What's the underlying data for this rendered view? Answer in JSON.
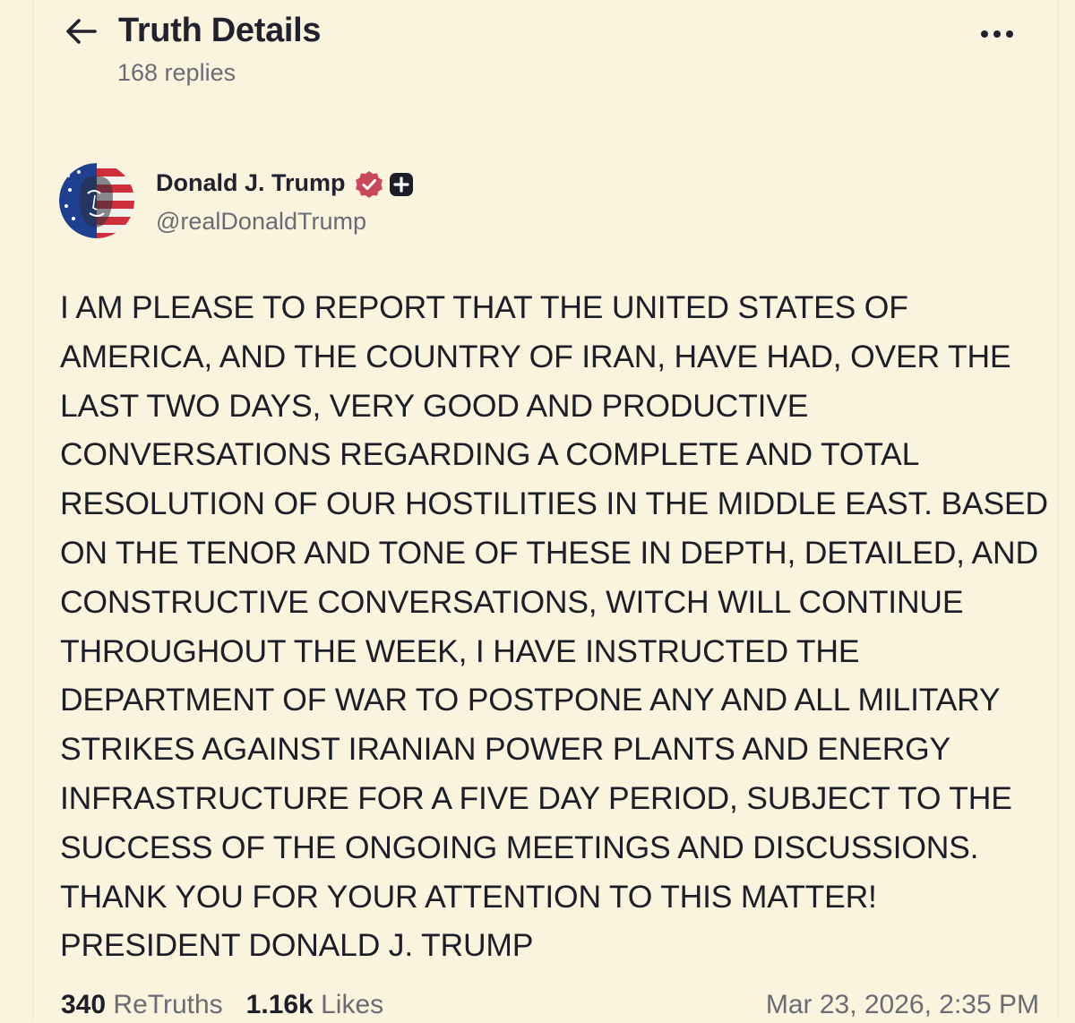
{
  "header": {
    "title": "Truth Details",
    "reply_count": "168 replies",
    "back_icon": "arrow-left-icon",
    "more_icon": "more-horizontal-icon"
  },
  "post": {
    "author": {
      "display_name": "Donald J. Trump",
      "handle": "@realDonaldTrump",
      "verified_icon": "verified-badge-icon",
      "plus_icon": "plus-badge-icon",
      "verified_color": "#c9485b"
    },
    "body_lines": [
      "I AM PLEASE TO REPORT THAT THE UNITED STATES OF",
      "AMERICA, AND THE COUNTRY OF IRAN, HAVE HAD, OVER THE",
      "LAST TWO DAYS, VERY GOOD AND PRODUCTIVE",
      "CONVERSATIONS REGARDING A COMPLETE AND TOTAL",
      "RESOLUTION OF OUR HOSTILITIES IN THE MIDDLE EAST. BASED",
      "ON THE TENOR AND TONE OF THESE IN DEPTH, DETAILED, AND",
      "CONSTRUCTIVE CONVERSATIONS, WITCH WILL CONTINUE",
      "THROUGHOUT THE WEEK, I HAVE INSTRUCTED THE",
      "DEPARTMENT OF WAR TO POSTPONE ANY AND ALL MILITARY",
      "STRIKES AGAINST IRANIAN POWER PLANTS AND ENERGY",
      "INFRASTRUCTURE FOR A FIVE DAY PERIOD, SUBJECT TO THE",
      "SUCCESS OF THE ONGOING MEETINGS AND DISCUSSIONS.",
      "THANK YOU FOR YOUR ATTENTION TO THIS MATTER!",
      "PRESIDENT DONALD J. TRUMP"
    ],
    "stats": {
      "retruths_count": "340",
      "retruths_label": "ReTruths",
      "likes_count": "1.16k",
      "likes_label": "Likes"
    },
    "timestamp": "Mar 23, 2026, 2:35 PM"
  },
  "colors": {
    "background": "#faf4df",
    "text": "#1e1e28",
    "muted": "#6b6b74",
    "badge_red": "#c9485b"
  }
}
